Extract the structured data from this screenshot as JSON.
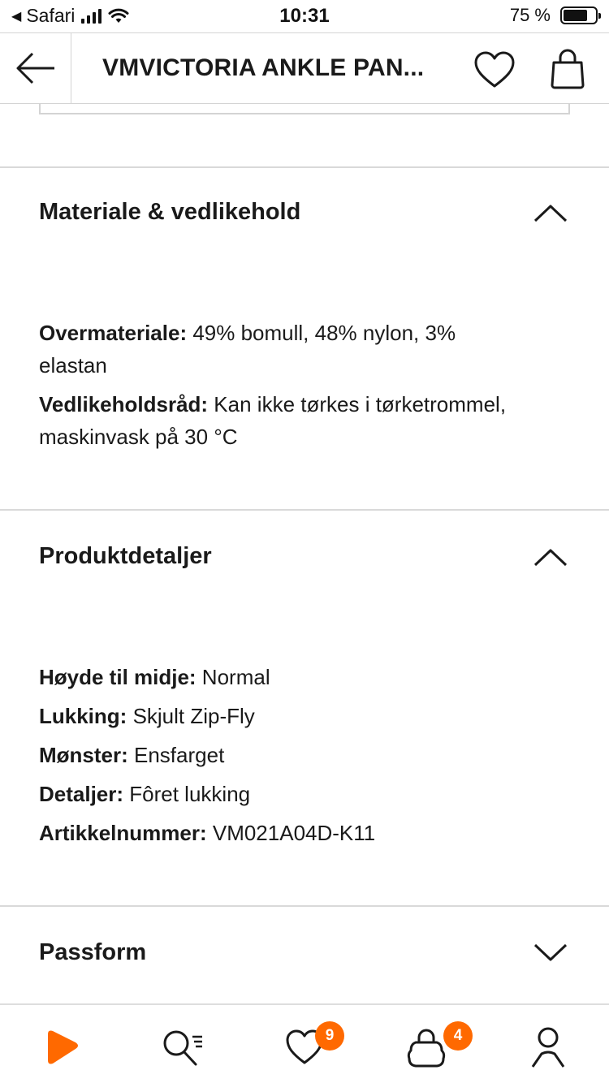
{
  "status_bar": {
    "carrier": "Safari",
    "time": "10:31",
    "battery_text": "75 %",
    "battery_level": 0.75
  },
  "header": {
    "title": "VMVICTORIA ANKLE PAN..."
  },
  "sections": {
    "material": {
      "title": "Materiale & vedlikehold",
      "expanded": true,
      "lines": [
        {
          "label": "Overmateriale:",
          "value": " 49% bomull, 48% nylon, 3%"
        },
        {
          "label": "",
          "value": "elastan"
        },
        {
          "label": "Vedlikeholdsråd:",
          "value": " Kan ikke tørkes i tørketrommel,"
        },
        {
          "label": "",
          "value": "maskinvask på 30 °C"
        }
      ]
    },
    "details": {
      "title": "Produktdetaljer",
      "expanded": true,
      "lines": [
        {
          "label": "Høyde til midje:",
          "value": " Normal"
        },
        {
          "label": "Lukking:",
          "value": " Skjult Zip-Fly"
        },
        {
          "label": "Mønster:",
          "value": " Ensfarget"
        },
        {
          "label": "Detaljer:",
          "value": " Fôret lukking"
        },
        {
          "label": "Artikkelnummer:",
          "value": " VM021A04D-K11"
        }
      ]
    },
    "fit": {
      "title": "Passform",
      "expanded": false
    }
  },
  "bottom_nav": {
    "items": [
      {
        "icon": "home-play-icon",
        "active": true
      },
      {
        "icon": "search-list-icon"
      },
      {
        "icon": "heart-icon",
        "badge": "9"
      },
      {
        "icon": "bag-icon",
        "badge": "4"
      },
      {
        "icon": "profile-icon"
      }
    ]
  },
  "colors": {
    "accent": "#ff6900",
    "text": "#1a1a1a",
    "divider": "#d9d9d9"
  }
}
